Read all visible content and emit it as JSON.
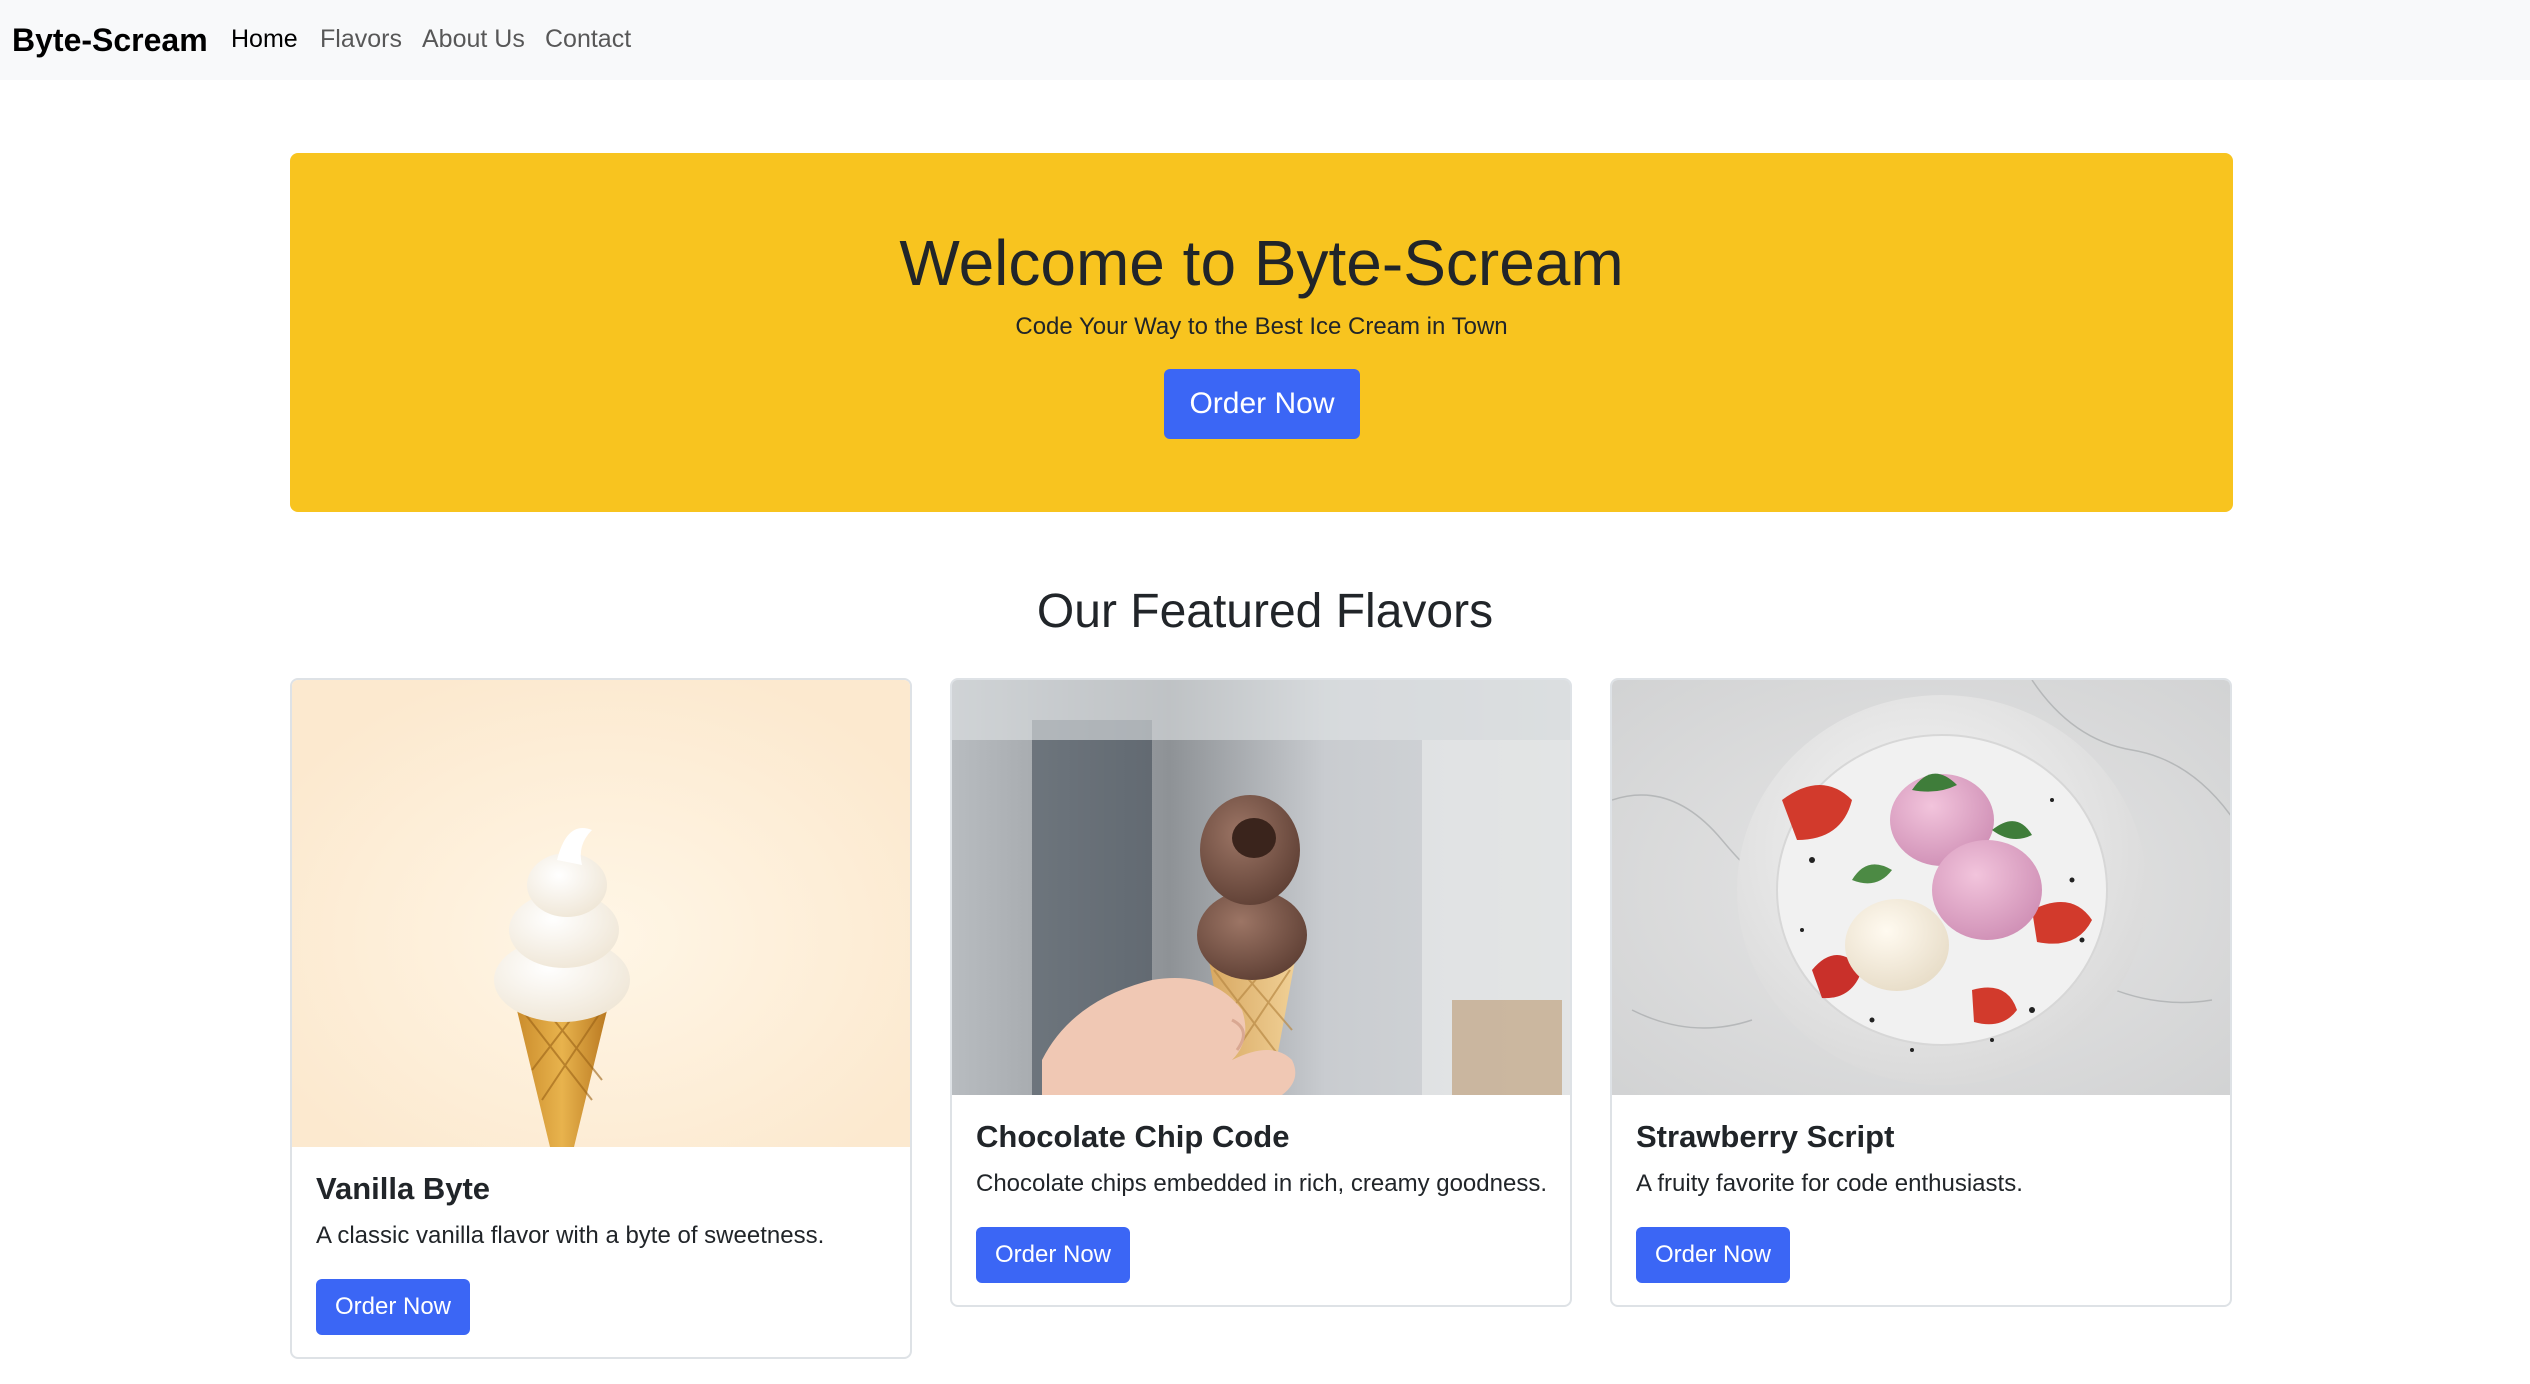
{
  "navbar": {
    "brand": "Byte-Scream",
    "links": [
      "Home",
      "Flavors",
      "About Us",
      "Contact"
    ]
  },
  "hero": {
    "title": "Welcome to Byte-Scream",
    "subtitle": "Code Your Way to the Best Ice Cream in Town",
    "button": "Order Now"
  },
  "featured": {
    "title": "Our Featured Flavors",
    "cards": [
      {
        "title": "Vanilla Byte",
        "text": "A classic vanilla flavor with a byte of sweetness.",
        "button": "Order Now",
        "image": "vanilla-soft-serve-cone-image"
      },
      {
        "title": "Chocolate Chip Code",
        "text": "Chocolate chips embedded in rich, creamy goodness.",
        "button": "Order Now",
        "image": "chocolate-ice-cream-cone-in-hand-image"
      },
      {
        "title": "Strawberry Script",
        "text": "A fruity favorite for code enthusiasts.",
        "button": "Order Now",
        "image": "strawberry-ice-cream-plate-image"
      }
    ]
  },
  "colors": {
    "hero_bg": "#f8c41f",
    "primary_button": "#3b66f5",
    "navbar_bg": "#f8f9fa"
  }
}
